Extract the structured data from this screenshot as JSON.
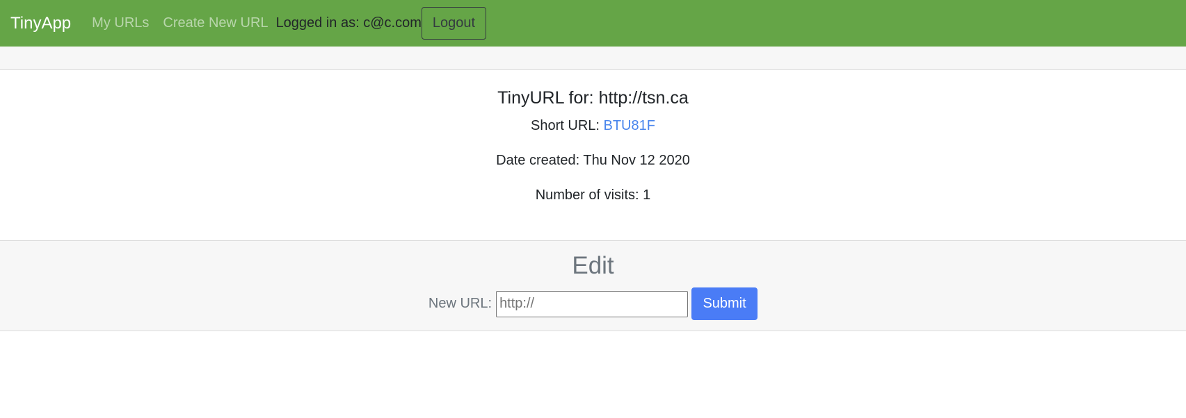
{
  "navbar": {
    "brand": "TinyApp",
    "links": [
      {
        "label": "My URLs"
      },
      {
        "label": "Create New URL"
      }
    ],
    "login_status": "Logged in as: c@c.com",
    "logout_label": "Logout"
  },
  "details": {
    "heading": "TinyURL for: http://tsn.ca",
    "short_url_label": "Short URL: ",
    "short_url_value": "BTU81F",
    "date_created": "Date created: Thu Nov 12 2020",
    "visits": "Number of visits: 1"
  },
  "edit": {
    "title": "Edit",
    "new_url_label": "New URL:",
    "new_url_placeholder": "http://",
    "new_url_value": "",
    "submit_label": "Submit"
  },
  "colors": {
    "navbar_bg": "#65a547",
    "link": "#4a86ed",
    "primary_button": "#4a7cf6"
  }
}
